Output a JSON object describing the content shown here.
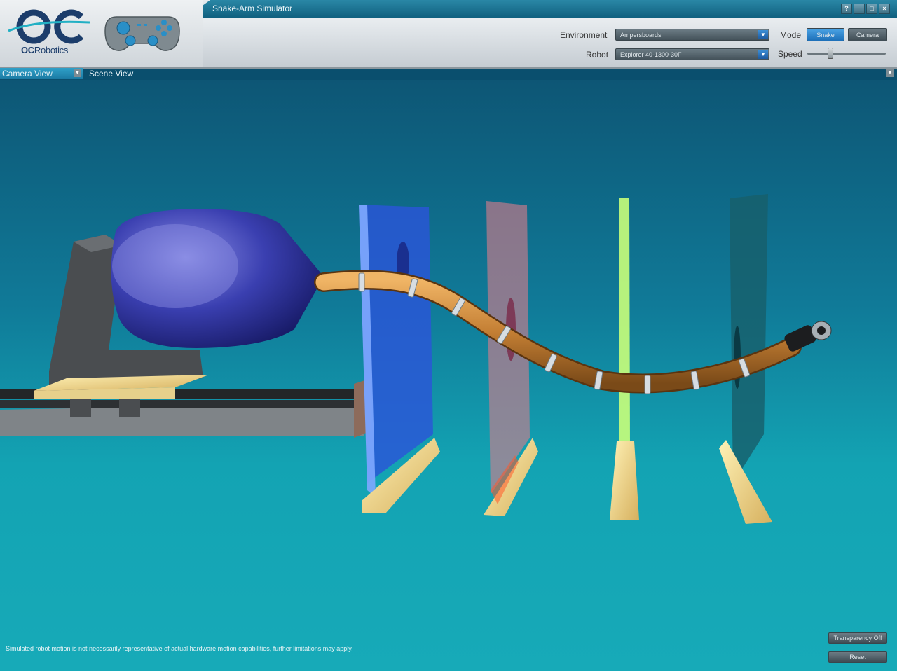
{
  "window": {
    "title": "Snake-Arm Simulator",
    "buttons": [
      "?",
      "_",
      "□",
      "×"
    ]
  },
  "logo": {
    "prefix": "OC",
    "suffix": "Robotics"
  },
  "toolbar": {
    "environment_label": "Environment",
    "environment_value": "Ampersboards",
    "robot_label": "Robot",
    "robot_value": "Explorer 40-1300-30F",
    "mode_label": "Mode",
    "mode_snake": "Snake",
    "mode_camera": "Camera",
    "speed_label": "Speed",
    "speed_value": 0.3
  },
  "view_tabs": {
    "camera_view": "Camera View",
    "scene_view": "Scene View"
  },
  "footer": {
    "disclaimer": "Simulated robot motion is not necessarily representative of actual hardware motion capabilities, further limitations may apply.",
    "transparency_button": "Transparency Off",
    "reset_button": "Reset"
  },
  "colors": {
    "accent_blue": "#1d7bc2",
    "viewport_top": "#0d5675",
    "viewport_bottom": "#17aab8",
    "snake_arm": "#c9833a"
  },
  "icons": [
    "oc-robotics-logo-icon",
    "gamepad-icon",
    "dropdown-arrow-icon",
    "help-icon",
    "minimize-icon",
    "maximize-icon",
    "close-icon"
  ]
}
